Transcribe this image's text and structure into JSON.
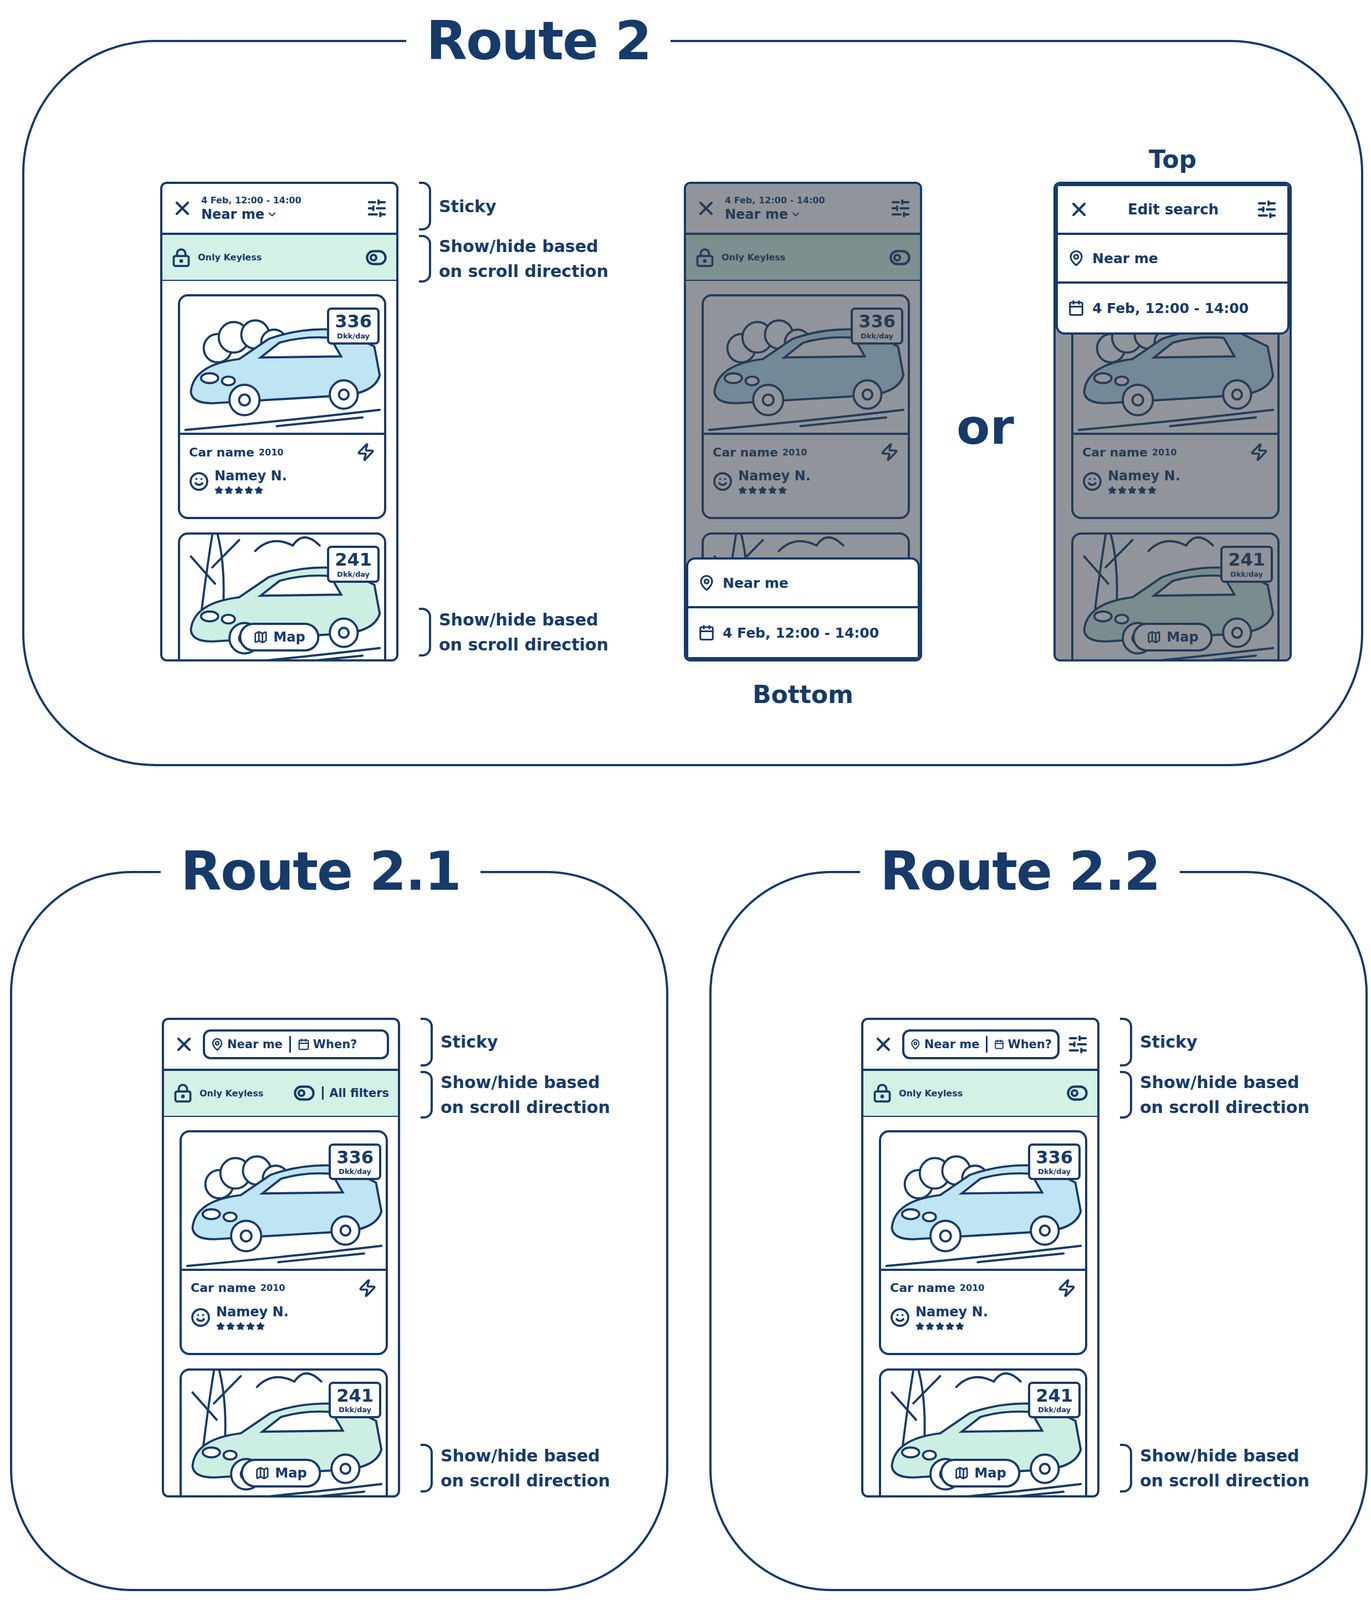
{
  "routes": [
    {
      "title": "Route 2",
      "screen": {
        "header": {
          "kind": "summary",
          "date": "4 Feb, 12:00 - 14:00",
          "location": "Near me",
          "filter_button": true
        },
        "filter_bar": {
          "label": "Only Keyless"
        },
        "cars": [
          {
            "price": "336",
            "unit": "Dkk/day",
            "name": "Car name",
            "year": "2010",
            "owner": "Namey N.",
            "stars": 5,
            "color": "#bfe4f3"
          },
          {
            "price": "241",
            "unit": "Dkk/day",
            "color": "#cdeee2"
          }
        ],
        "map_button": "Map"
      },
      "annotations": [
        "Sticky",
        "Show/hide based on scroll direction",
        "Show/hide based on scroll direction"
      ],
      "separator": "or",
      "variants": [
        {
          "caption": "Bottom",
          "screen": {
            "dimmed": true,
            "header": {
              "kind": "summary",
              "date": "4 Feb, 12:00 - 14:00",
              "location": "Near me",
              "filter_button": true
            },
            "filter_bar": {
              "label": "Only Keyless"
            },
            "cars": [
              {
                "price": "336",
                "unit": "Dkk/day",
                "name": "Car name",
                "year": "2010",
                "owner": "Namey N.",
                "stars": 5,
                "color": "#bfe4f3"
              },
              {
                "color": "#cdeee2"
              }
            ],
            "sheet": {
              "kind": "bottom",
              "fields": [
                {
                  "kind": "location",
                  "text": "Near me"
                },
                {
                  "kind": "date",
                  "text": "4 Feb, 12:00 - 14:00"
                }
              ]
            }
          }
        },
        {
          "caption": "Top",
          "screen": {
            "dimmed": true,
            "cars": [
              {
                "name": "Car name",
                "year": "2010",
                "owner": "Namey N.",
                "stars": 5,
                "color": "#bfe4f3"
              },
              {
                "price": "241",
                "unit": "Dkk/day",
                "color": "#cdeee2"
              }
            ],
            "map_button": "Map",
            "sheet": {
              "kind": "top",
              "title": "Edit search",
              "fields": [
                {
                  "kind": "location",
                  "text": "Near me"
                },
                {
                  "kind": "date",
                  "text": "4 Feb, 12:00 - 14:00"
                }
              ]
            }
          }
        }
      ]
    },
    {
      "title": "Route 2.1",
      "screen": {
        "header": {
          "kind": "pill",
          "location": "Near me",
          "when": "When?",
          "filter_button": false
        },
        "filter_bar": {
          "label": "Only Keyless",
          "all_filters": "All filters"
        },
        "cars": [
          {
            "price": "336",
            "unit": "Dkk/day",
            "name": "Car name",
            "year": "2010",
            "owner": "Namey N.",
            "stars": 5,
            "color": "#bfe4f3"
          },
          {
            "price": "241",
            "unit": "Dkk/day",
            "color": "#cdeee2"
          }
        ],
        "map_button": "Map"
      },
      "annotations": [
        "Sticky",
        "Show/hide based on scroll direction",
        "Show/hide based on scroll direction"
      ]
    },
    {
      "title": "Route 2.2",
      "screen": {
        "header": {
          "kind": "pill",
          "location": "Near me",
          "when": "When?",
          "filter_button": true
        },
        "filter_bar": {
          "label": "Only Keyless"
        },
        "cars": [
          {
            "price": "336",
            "unit": "Dkk/day",
            "name": "Car name",
            "year": "2010",
            "owner": "Namey N.",
            "stars": 5,
            "color": "#bfe4f3"
          },
          {
            "price": "241",
            "unit": "Dkk/day",
            "color": "#cdeee2"
          }
        ],
        "map_button": "Map"
      },
      "annotations": [
        "Sticky",
        "Show/hide based on scroll direction",
        "Show/hide based on scroll direction"
      ]
    }
  ]
}
